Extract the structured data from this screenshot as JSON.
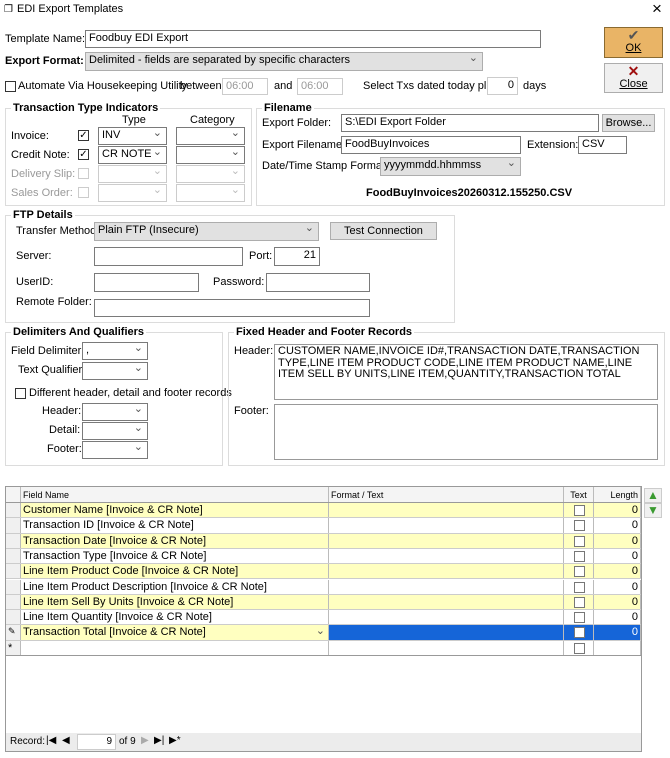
{
  "window": {
    "title": "EDI Export Templates",
    "close": "×"
  },
  "template_name": {
    "label": "Template Name:",
    "value": "Foodbuy EDI Export"
  },
  "export_format": {
    "label": "Export Format:",
    "value": "Delimited - fields are separated by specific characters"
  },
  "buttons": {
    "ok": "OK",
    "close": "Close",
    "browse": "Browse...",
    "test_connection": "Test Connection"
  },
  "automate": {
    "label": "Automate Via Housekeeping Utility",
    "checked": false,
    "between": "between",
    "from": "06:00",
    "and": "and",
    "to": "06:00",
    "select_label": "Select Txs dated today plus",
    "days_value": "0",
    "days": "days"
  },
  "txn_types": {
    "title": "Transaction Type Indicators",
    "type_header": "Type",
    "category_header": "Category",
    "rows": [
      {
        "label": "Invoice:",
        "checked": true,
        "type": "INV",
        "enabled": true
      },
      {
        "label": "Credit Note:",
        "checked": true,
        "type": "CR NOTE",
        "enabled": true
      },
      {
        "label": "Delivery Slip:",
        "checked": false,
        "type": "",
        "enabled": false
      },
      {
        "label": "Sales Order:",
        "checked": false,
        "type": "",
        "enabled": false
      }
    ]
  },
  "filename": {
    "title": "Filename",
    "folder_label": "Export Folder:",
    "folder": "S:\\EDI Export Folder",
    "file_label": "Export Filename:",
    "file": "FoodBuyInvoices",
    "ext_label": "Extension:",
    "ext": "CSV",
    "stamp_label": "Date/Time Stamp Format:",
    "stamp": "yyyymmdd.hhmmss",
    "preview": "FoodBuyInvoices20260312.155250.CSV"
  },
  "ftp": {
    "title": "FTP Details",
    "method_label": "Transfer Method:",
    "method": "Plain FTP (Insecure)",
    "server_label": "Server:",
    "server": "",
    "port_label": "Port:",
    "port": "21",
    "user_label": "UserID:",
    "user": "",
    "password_label": "Password:",
    "password": "",
    "remote_label": "Remote Folder:",
    "remote": ""
  },
  "delims": {
    "title": "Delimiters And Qualifiers",
    "field_label": "Field Delimiter:",
    "field": ",",
    "text_label": "Text Qualifier:",
    "text": "",
    "diff_label": "Different header, detail and footer records",
    "header_label": "Header:",
    "detail_label": "Detail:",
    "footer_label": "Footer:"
  },
  "fixed": {
    "title": "Fixed Header and Footer Records",
    "header_label": "Header:",
    "header": "CUSTOMER NAME,INVOICE ID#,TRANSACTION DATE,TRANSACTION TYPE,LINE ITEM PRODUCT CODE,LINE ITEM PRODUCT NAME,LINE ITEM SELL BY UNITS,LINE ITEM,QUANTITY,TRANSACTION TOTAL",
    "footer_label": "Footer:",
    "footer": ""
  },
  "grid": {
    "columns": [
      "Field Name",
      "Format / Text",
      "Text",
      "Length"
    ],
    "rows": [
      {
        "field": "Customer Name [Invoice & CR Note]",
        "format": "",
        "text": false,
        "length": "0"
      },
      {
        "field": "Transaction ID [Invoice & CR Note]",
        "format": "",
        "text": false,
        "length": "0"
      },
      {
        "field": "Transaction Date  [Invoice & CR Note]",
        "format": "",
        "text": false,
        "length": "0"
      },
      {
        "field": "Transaction Type [Invoice & CR Note]",
        "format": "",
        "text": false,
        "length": "0"
      },
      {
        "field": "Line Item Product Code [Invoice & CR Note]",
        "format": "",
        "text": false,
        "length": "0"
      },
      {
        "field": "Line Item Product Description [Invoice & CR Note]",
        "format": "",
        "text": false,
        "length": "0"
      },
      {
        "field": "Line Item Sell By Units [Invoice & CR Note]",
        "format": "",
        "text": false,
        "length": "0"
      },
      {
        "field": "Line Item Quantity [Invoice & CR Note]",
        "format": "",
        "text": false,
        "length": "0"
      },
      {
        "field": "Transaction Total [Invoice & CR Note]",
        "format": "",
        "text": false,
        "length": "0"
      }
    ],
    "nav": {
      "label": "Record:",
      "current": "9",
      "of": "of 9"
    }
  },
  "colors": {
    "accent": "#1565d8",
    "row_highlight": "#ffffc0",
    "ok": "#e9b466"
  }
}
